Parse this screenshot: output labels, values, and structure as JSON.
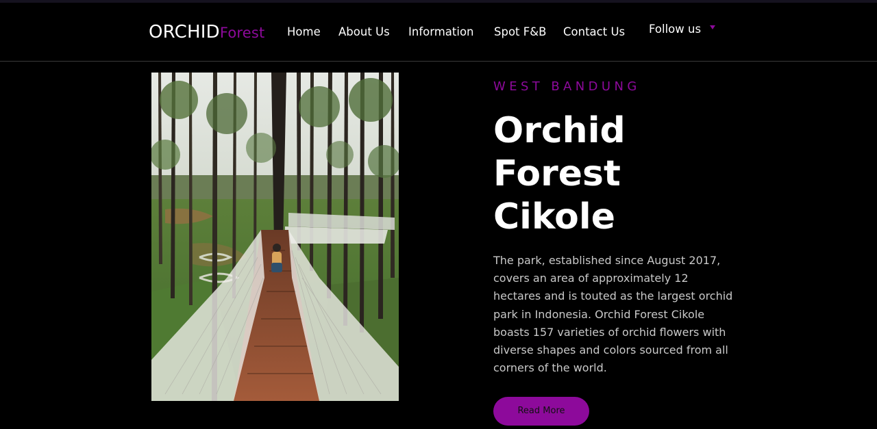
{
  "brand": {
    "name_main": "ORCHID",
    "name_accent": "Forest"
  },
  "nav": {
    "items": [
      {
        "label": "Home"
      },
      {
        "label": "About Us"
      },
      {
        "label": "Information"
      },
      {
        "label": "Spot F&B"
      },
      {
        "label": "Contact Us"
      }
    ],
    "follow_label": "Follow us"
  },
  "hero": {
    "kicker": "WEST BANDUNG",
    "title_lines": [
      "Orchid",
      "Forest",
      "Cikole"
    ],
    "description": "The park, established since August 2017, covers an area of approximately 12 hectares and is touted as the largest orchid park in Indonesia. Orchid Forest Cikole boasts 157 varieties of orchid flowers with diverse shapes and colors sourced from all corners of the world.",
    "button_label": "Read More"
  },
  "colors": {
    "accent": "#8d0a9b",
    "background": "#000000",
    "text": "#ffffff",
    "muted_text": "#c9c9c9"
  }
}
